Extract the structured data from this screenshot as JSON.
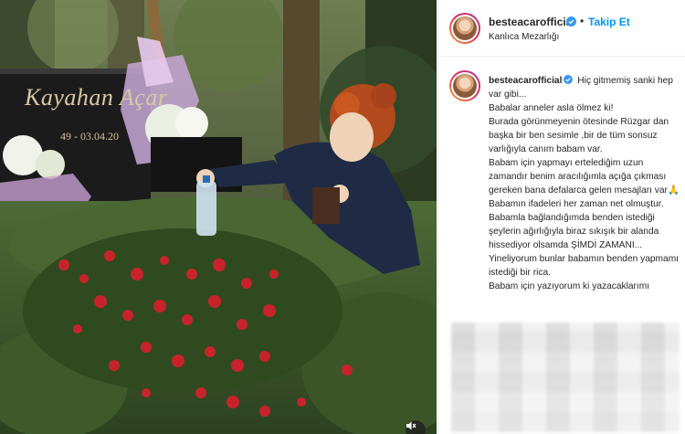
{
  "post": {
    "media": {
      "headstone_text": "Kayahan Açar",
      "headstone_dates": "49 - 03.04.20",
      "mute_icon": "speaker-muted-icon"
    },
    "header": {
      "username": "besteacarofficial",
      "separator": "•",
      "follow_label": "Takip Et",
      "location": "Kanlıca Mezarlığı"
    },
    "caption": {
      "username": "besteacarofficial",
      "lines": [
        " Hiç gitmemiş sanki hep var gibi...",
        "Babalar anneler asla ölmez ki!",
        "Burada görünmeyenin ötesinde Rüzgar dan başka bir ben sesimle ,bir de tüm sonsuz varlığıyla canım babam var.",
        "Babam için yapmayı ertelediğim uzun zamandır benim aracılığımla açığa çıkması gereken bana defalarca gelen mesajları var🙏",
        "Babamın ifadeleri her zaman net olmuştur.",
        "Babamla bağlandığımda benden istediği şeylerin ağırlığıyla biraz sıkışık bir alanda hissediyor olsamda ŞİMDİ ZAMANI...",
        "Yineliyorum bunlar babamın benden yapmamı istediği bir rica.",
        "Babam için yazıyorum ki yazacaklarımı"
      ]
    }
  },
  "colors": {
    "accent_blue": "#0095f6",
    "text": "#262626",
    "verified": "#3897f0"
  }
}
